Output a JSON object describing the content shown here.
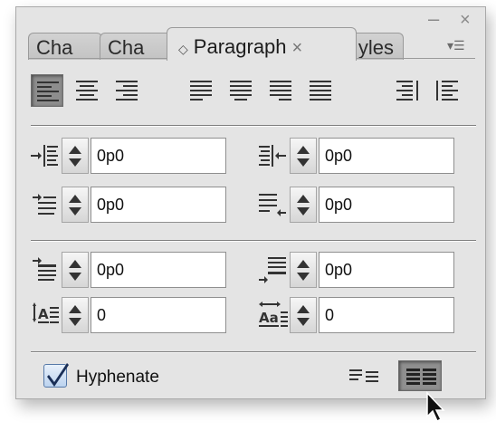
{
  "tabs": [
    {
      "label": "Cha"
    },
    {
      "label": "Cha"
    },
    {
      "label": "Paragraph",
      "active": true
    },
    {
      "label": "yles"
    }
  ],
  "window": {
    "minimize": "–",
    "close": "×",
    "menu": "▾☰"
  },
  "active_tab_icon": "◇",
  "tab_close": "×",
  "alignment": {
    "buttons": [
      {
        "name": "align-left",
        "selected": true
      },
      {
        "name": "align-center",
        "selected": false
      },
      {
        "name": "align-right",
        "selected": false
      },
      {
        "name": "justify-left",
        "selected": false
      },
      {
        "name": "justify-center",
        "selected": false
      },
      {
        "name": "justify-right",
        "selected": false
      },
      {
        "name": "justify-all",
        "selected": false
      },
      {
        "name": "align-toward-spine",
        "selected": false
      },
      {
        "name": "align-away-from-spine",
        "selected": false
      }
    ]
  },
  "fields": {
    "left_indent": "0p0",
    "right_indent": "0p0",
    "first_line_indent": "0p0",
    "last_line_right_indent": "0p0",
    "space_before": "0p0",
    "space_after": "0p0",
    "drop_cap_lines": "0",
    "drop_cap_chars": "0"
  },
  "hyphenate": {
    "label": "Hyphenate",
    "checked": true
  },
  "composer": [
    {
      "name": "balance-ragged-lines",
      "selected": false
    },
    {
      "name": "justification-grid",
      "selected": true
    }
  ],
  "colors": {
    "panel": "#e4e4e4",
    "selected_button": "#8d8d8d",
    "checkbox": "#bcd3ef"
  }
}
